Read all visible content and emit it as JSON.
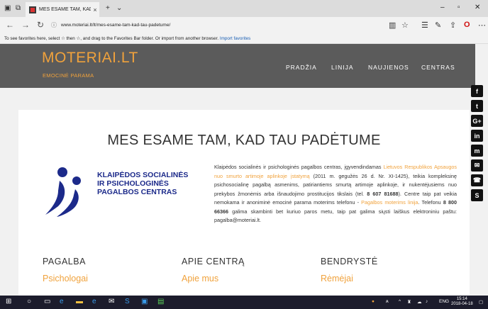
{
  "browser": {
    "tab_title": "MES ESAME TAM, KAD",
    "url": "www.moteriai.lt/lt/mes-esame-tam-kad-tau-padetume/",
    "favbar_text": "To see favorites here, select ☆ then ☆, and drag to the Favorites Bar folder. Or import from another browser.",
    "favbar_link": "Import favorites"
  },
  "site": {
    "brand": "MOTERIAI.LT",
    "tagline": "EMOCINĖ PARAMA",
    "menu": [
      "PRADŽIA",
      "LINIJA",
      "NAUJIENOS",
      "CENTRAS"
    ]
  },
  "social": [
    "f",
    "t",
    "G+",
    "in",
    "m",
    "✉",
    "☎",
    "S"
  ],
  "main": {
    "heading": "MES ESAME TAM, KAD TAU PADĖTUME",
    "logo_lines": [
      "KLAIPĖDOS SOCIALINĖS",
      "IR PSICHOLOGINĖS",
      "PAGALBOS CENTRAS"
    ],
    "para": {
      "p1": "Klaipėdos socialinės ir psichologinės pagalbos centras, įgyvendindamas ",
      "link1": "Lietuvos Respublikos Apsaugos nuo smurto artimoje aplinkoje įstatymą",
      "p2": " (2011 m. gegužės 26 d. Nr. XI-1425), teikia kompleksinę psichosocialinę pagalbą asmenims, patiriantiems smurtą artimoje aplinkoje, ir nukentėjusiems nuo prekybos žmonėmis arba išnaudojimo prostitucijos tikslais (tel. ",
      "phone1": "8 607 81688",
      "p3": "). Centre taip pat veikia nemokama ir anoniminė emocinė parama moterims telefonu - ",
      "link2": "Pagalbos moterims linija",
      "p4": ". Telefonu ",
      "phone2": "8 800 66366",
      "p5": " galima skambinti bet kuriuo paros metu, taip pat galima siųsti laiškus elektroniniu paštu: pagalba@moteriai.lt."
    },
    "columns": [
      {
        "heading": "PAGALBA",
        "link": "Psichologai"
      },
      {
        "heading": "APIE CENTRĄ",
        "link": "Apie mus"
      },
      {
        "heading": "BENDRYSTĖ",
        "link": "Rėmėjai"
      }
    ]
  },
  "taskbar": {
    "time": "15:14",
    "date": "2018-04-18",
    "lang": "ENG"
  },
  "colors": {
    "accent": "#f0a23c",
    "header_bg": "#5b5b5b",
    "logo_blue": "#1c2a8a"
  }
}
